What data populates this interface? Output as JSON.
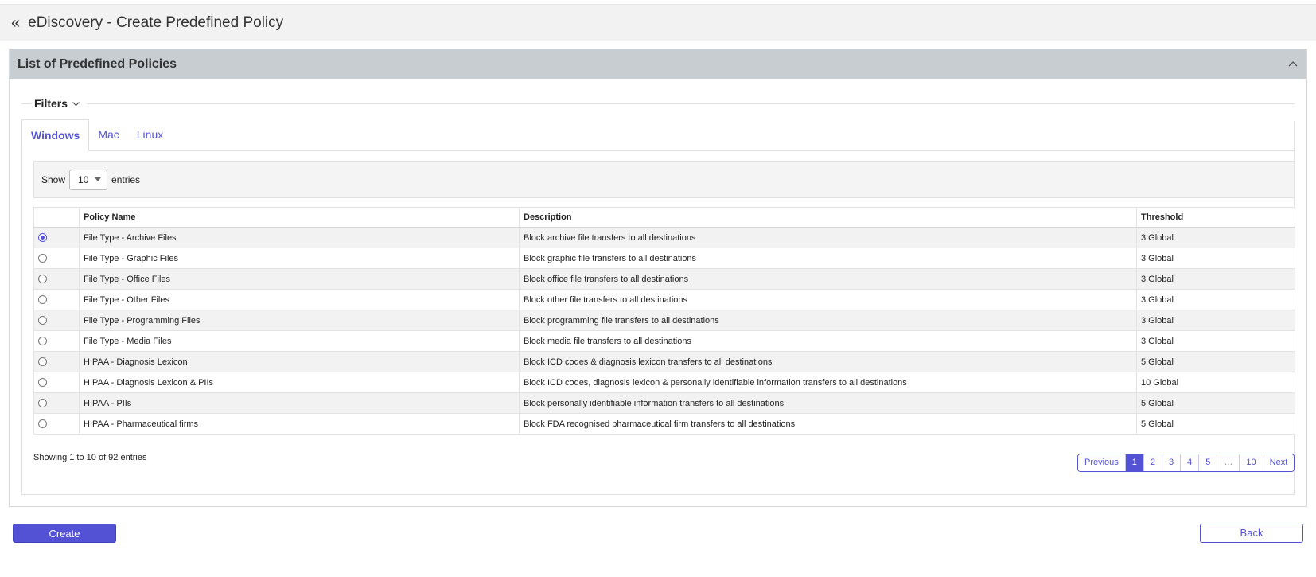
{
  "header": {
    "back_glyph": "«",
    "title": "eDiscovery - Create Predefined Policy"
  },
  "card": {
    "title": "List of Predefined Policies",
    "collapse_icon": "chevron-up-icon"
  },
  "filters": {
    "label": "Filters",
    "icon": "chevron-down-icon"
  },
  "tabs": [
    {
      "label": "Windows",
      "active": true
    },
    {
      "label": "Mac",
      "active": false
    },
    {
      "label": "Linux",
      "active": false
    }
  ],
  "length_menu": {
    "show_label": "Show",
    "value": "10",
    "entries_label": "entries"
  },
  "table": {
    "columns": [
      "",
      "Policy Name",
      "Description",
      "Threshold"
    ],
    "rows": [
      {
        "name": "File Type - Archive Files",
        "description": "Block archive file transfers to all destinations",
        "threshold": "3 Global",
        "selected": true
      },
      {
        "name": "File Type - Graphic Files",
        "description": "Block graphic file transfers to all destinations",
        "threshold": "3 Global",
        "selected": false
      },
      {
        "name": "File Type - Office Files",
        "description": "Block office file transfers to all destinations",
        "threshold": "3 Global",
        "selected": false
      },
      {
        "name": "File Type - Other Files",
        "description": "Block other file transfers to all destinations",
        "threshold": "3 Global",
        "selected": false
      },
      {
        "name": "File Type - Programming Files",
        "description": "Block programming file transfers to all destinations",
        "threshold": "3 Global",
        "selected": false
      },
      {
        "name": "File Type - Media Files",
        "description": "Block media file transfers to all destinations",
        "threshold": "3 Global",
        "selected": false
      },
      {
        "name": "HIPAA - Diagnosis Lexicon",
        "description": "Block ICD codes & diagnosis lexicon transfers to all destinations",
        "threshold": "5 Global",
        "selected": false
      },
      {
        "name": "HIPAA - Diagnosis Lexicon & PIIs",
        "description": "Block ICD codes, diagnosis lexicon & personally identifiable information transfers to all destinations",
        "threshold": "10 Global",
        "selected": false
      },
      {
        "name": "HIPAA - PIIs",
        "description": "Block personally identifiable information transfers to all destinations",
        "threshold": "5 Global",
        "selected": false
      },
      {
        "name": "HIPAA - Pharmaceutical firms",
        "description": "Block FDA recognised pharmaceutical firm transfers to all destinations",
        "threshold": "5 Global",
        "selected": false
      }
    ]
  },
  "info": "Showing 1 to 10 of 92 entries",
  "pagination": {
    "previous": "Previous",
    "pages": [
      {
        "label": "1",
        "active": true
      },
      {
        "label": "2",
        "active": false
      },
      {
        "label": "3",
        "active": false
      },
      {
        "label": "4",
        "active": false
      },
      {
        "label": "5",
        "active": false
      },
      {
        "label": "…",
        "active": false,
        "ellipsis": true
      },
      {
        "label": "10",
        "active": false
      }
    ],
    "next": "Next"
  },
  "buttons": {
    "create": "Create",
    "back": "Back"
  },
  "colors": {
    "accent": "#5352d4",
    "header_band": "#c8cdd2",
    "topbar": "#f2f2f2"
  }
}
